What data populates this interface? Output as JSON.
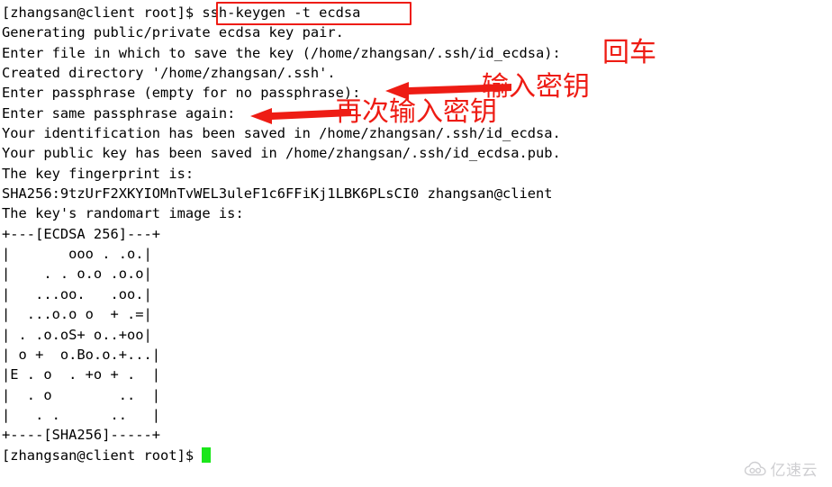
{
  "terminal": {
    "lines": [
      "[zhangsan@client root]$ ssh-keygen -t ecdsa",
      "Generating public/private ecdsa key pair.",
      "Enter file in which to save the key (/home/zhangsan/.ssh/id_ecdsa):",
      "Created directory '/home/zhangsan/.ssh'.",
      "Enter passphrase (empty for no passphrase):",
      "Enter same passphrase again:",
      "Your identification has been saved in /home/zhangsan/.ssh/id_ecdsa.",
      "Your public key has been saved in /home/zhangsan/.ssh/id_ecdsa.pub.",
      "The key fingerprint is:",
      "SHA256:9tzUrF2XKYIOMnTvWEL3uleF1c6FFiKj1LBK6PLsCI0 zhangsan@client",
      "The key's randomart image is:",
      "+---[ECDSA 256]---+",
      "|       ooo . .o.|",
      "|    . . o.o .o.o|",
      "|   ...oo.   .oo.|",
      "|  ...o.o o  + .=|",
      "| . .o.oS+ o..+oo|",
      "| o +  o.Bo.o.+...|",
      "|E . o  . +o + .  |",
      "|  . o        ..  |",
      "|   . .      ..   |",
      "+----[SHA256]-----+",
      "[zhangsan@client root]$ "
    ],
    "prompt": "[zhangsan@client root]$",
    "command": "ssh-keygen -t ecdsa",
    "cursor_color": "#1ae61a"
  },
  "annotations": {
    "accent_color": "#ee1c14",
    "command_highlight": {
      "label": "ssh-keygen -t ecdsa"
    },
    "labels": [
      {
        "id": "enter-key",
        "text": "回车"
      },
      {
        "id": "input-passphrase",
        "text": "输入密钥"
      },
      {
        "id": "input-passphrase-again",
        "text": "再次输入密钥"
      }
    ]
  },
  "watermark": {
    "text": "亿速云",
    "icon": "cloud-icon"
  }
}
